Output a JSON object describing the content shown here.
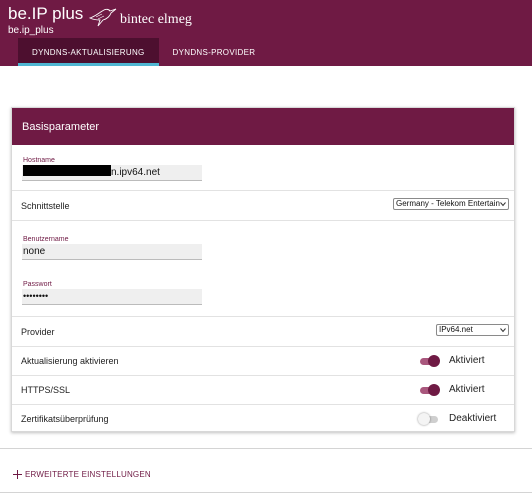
{
  "header": {
    "product_name": "be.IP plus",
    "product_id": "be.ip_plus",
    "brand": "bintec elmeg",
    "tabs": [
      {
        "label": "DYNDNS-AKTUALISIERUNG",
        "active": true
      },
      {
        "label": "DYNDNS-PROVIDER",
        "active": false
      }
    ]
  },
  "section": {
    "title": "Basisparameter",
    "hostname": {
      "caption": "Hostname",
      "value_suffix": "n.ipv64.net"
    },
    "interface": {
      "label": "Schnittstelle",
      "selected": "Germany - Telekom Entertain"
    },
    "username": {
      "caption": "Benutzername",
      "value": "none"
    },
    "password": {
      "caption": "Passwort",
      "value": "••••••••"
    },
    "provider": {
      "label": "Provider",
      "selected": "IPv64.net"
    },
    "update_enable": {
      "label": "Aktualisierung aktivieren",
      "state": "Aktiviert",
      "on": true
    },
    "https": {
      "label": "HTTPS/SSL",
      "state": "Aktiviert",
      "on": true
    },
    "cert_check": {
      "label": "Zertifikatsüberprüfung",
      "state": "Deaktiviert",
      "on": false
    }
  },
  "advanced": {
    "label": "ERWEITERTE EINSTELLUNGEN"
  },
  "colors": {
    "primary": "#6f1a44",
    "tab_indicator": "#4fb6d2"
  }
}
